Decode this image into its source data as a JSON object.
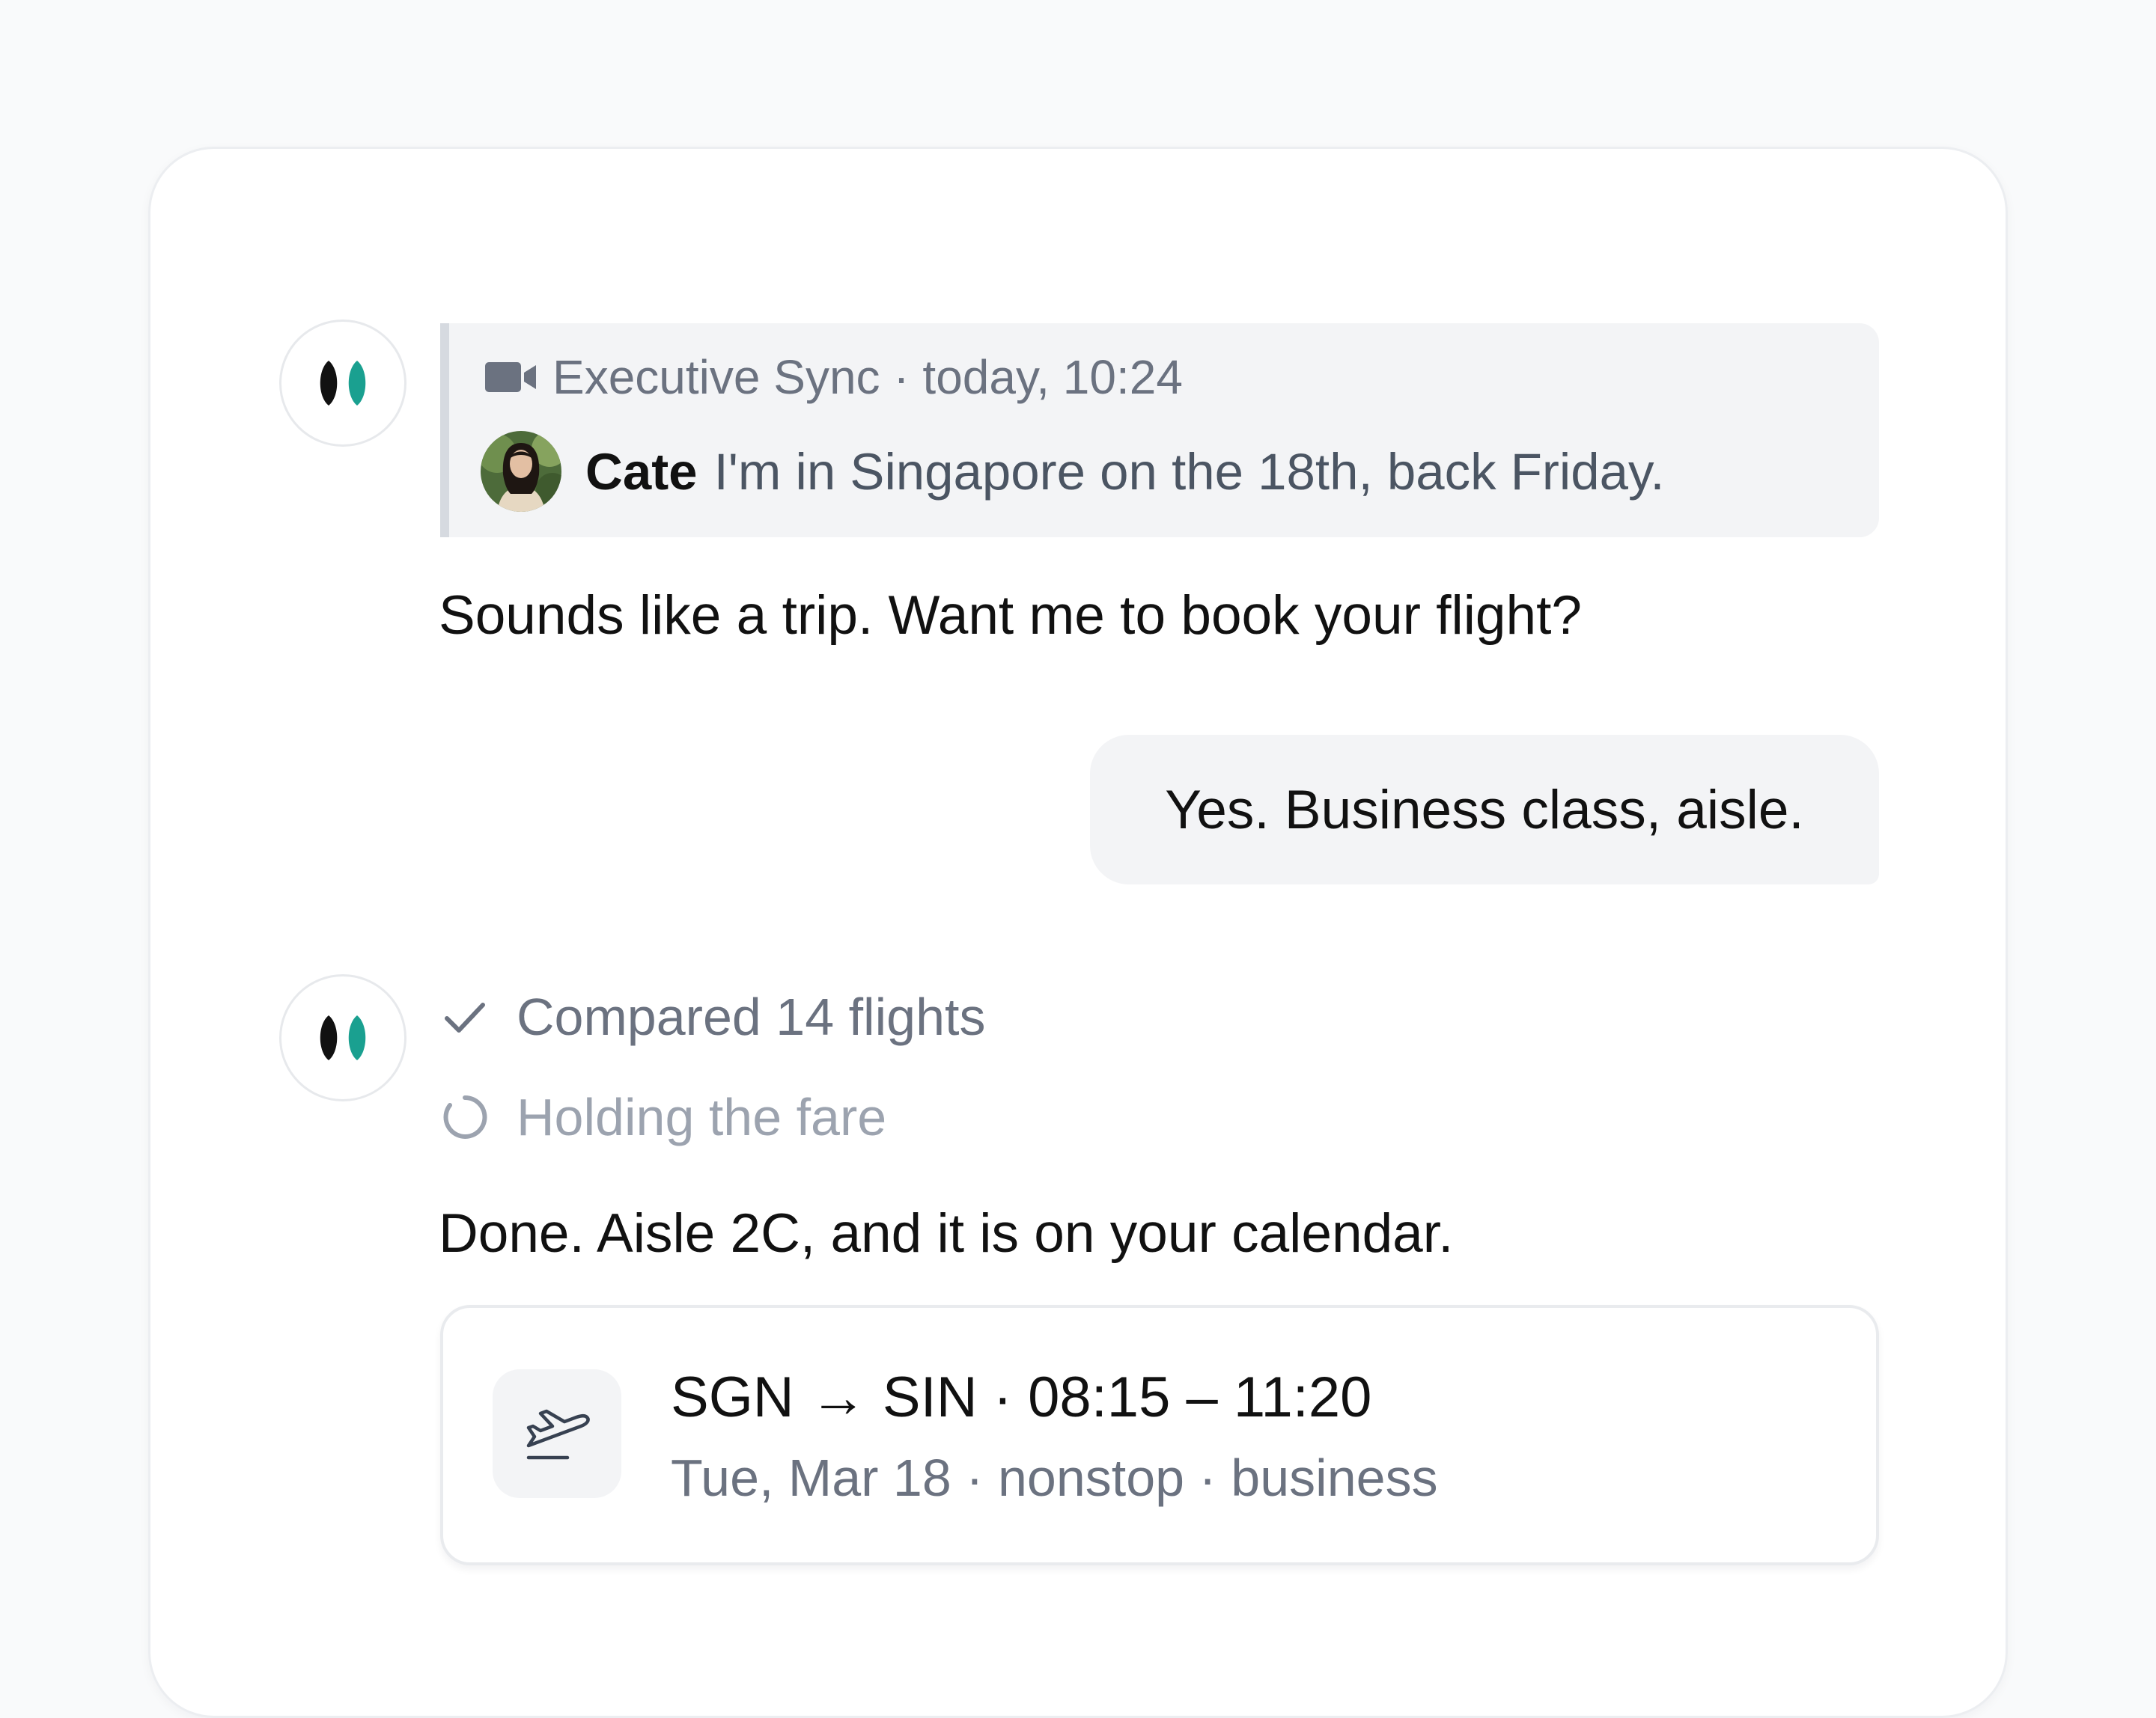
{
  "colors": {
    "page_background": "#f9fafb",
    "card_background": "#ffffff",
    "brand_dark": "#111111",
    "brand_teal": "#1aa090",
    "muted_text": "#6b7280",
    "faint_text": "#9ca3af",
    "bubble_background": "#f3f4f6"
  },
  "icons": {
    "assistant": "assistant-logo-icon",
    "meeting": "video-camera-icon",
    "step_done": "checkmark-icon",
    "step_pending": "spinner-icon",
    "flight": "airplane-takeoff-icon"
  },
  "quote": {
    "meeting_title": "Executive Sync · today, 10:24",
    "sender_name": "Cate",
    "message": "I'm in Singapore on the 18th, back Friday."
  },
  "assistant_message_1": "Sounds like a trip. Want me to book your flight?",
  "user_message": "Yes. Business class, aisle.",
  "steps": [
    {
      "label": "Compared 14 flights",
      "status": "done"
    },
    {
      "label": "Holding the fare",
      "status": "in-progress"
    }
  ],
  "assistant_message_2": "Done. Aisle 2C, and it is on your calendar.",
  "flight_card": {
    "route": "SGN → SIN · 08:15 – 11:20",
    "details": "Tue, Mar 18 · nonstop · business"
  }
}
